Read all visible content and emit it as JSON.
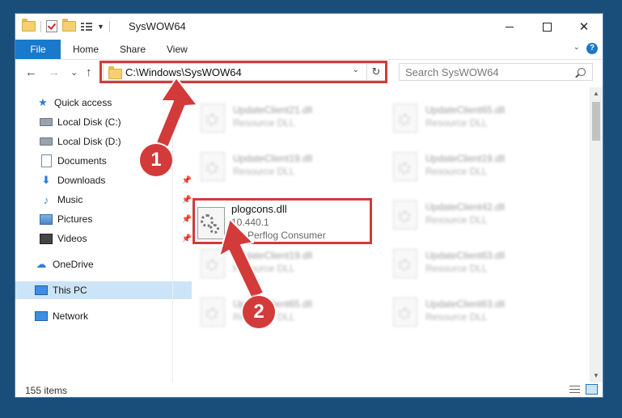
{
  "window": {
    "title": "SysWOW64",
    "minimize_icon": "minimize-icon",
    "maximize_icon": "maximize-icon",
    "close_icon": "close-icon",
    "close_glyph": "✕"
  },
  "ribbon": {
    "tabs": [
      {
        "label": "File"
      },
      {
        "label": "Home"
      },
      {
        "label": "Share"
      },
      {
        "label": "View"
      }
    ],
    "help_glyph": "?"
  },
  "navbar": {
    "back_glyph": "←",
    "forward_glyph": "→",
    "recent_glyph": "⌄",
    "up_glyph": "↑",
    "address": "C:\\Windows\\SysWOW64",
    "refresh_glyph": "↻",
    "search_placeholder": "Search SysWOW64"
  },
  "sidebar": {
    "items": [
      {
        "label": "Quick access",
        "icon": "star-icon"
      },
      {
        "label": "Local Disk (C:)",
        "icon": "drive-icon"
      },
      {
        "label": "Local Disk (D:)",
        "icon": "drive-icon"
      },
      {
        "label": "Documents",
        "icon": "document-icon"
      },
      {
        "label": "Downloads",
        "icon": "download-icon"
      },
      {
        "label": "Music",
        "icon": "music-icon"
      },
      {
        "label": "Pictures",
        "icon": "pictures-icon"
      },
      {
        "label": "Videos",
        "icon": "video-icon"
      },
      {
        "label": "OneDrive",
        "icon": "cloud-icon"
      },
      {
        "label": "This PC",
        "icon": "computer-icon"
      },
      {
        "label": "Network",
        "icon": "network-icon"
      }
    ]
  },
  "files": [
    {
      "name": "UpdateClient21.dll",
      "desc": "Resource DLL"
    },
    {
      "name": "UpdateClient65.dll",
      "desc": "Resource DLL"
    },
    {
      "name": "UpdateClient19.dll",
      "desc": "Resource DLL"
    },
    {
      "name": "UpdateClient19.dll",
      "desc": "Resource DLL"
    },
    {
      "name": "UpdateClient42.dll",
      "desc": "Resource DLL"
    },
    {
      "name": "UpdateClient19.dll",
      "desc": "Resource DLL"
    },
    {
      "name": "UpdateClient63.dll",
      "desc": "Resource DLL"
    },
    {
      "name": "UpdateClient65.dll",
      "desc": "Resource DLL"
    },
    {
      "name": "UpdateClient63.dll",
      "desc": "Resource DLL"
    }
  ],
  "highlighted_file": {
    "name": "plogcons.dll",
    "version": "10.440.1",
    "description": "AC Perflog Consumer"
  },
  "status": {
    "item_count": "155 items"
  },
  "annotations": {
    "step1": "1",
    "step2": "2",
    "color": "#d33a3a"
  },
  "colors": {
    "accent": "#1979ca",
    "selection": "#cce4f7",
    "highlight": "#d33a3a"
  }
}
